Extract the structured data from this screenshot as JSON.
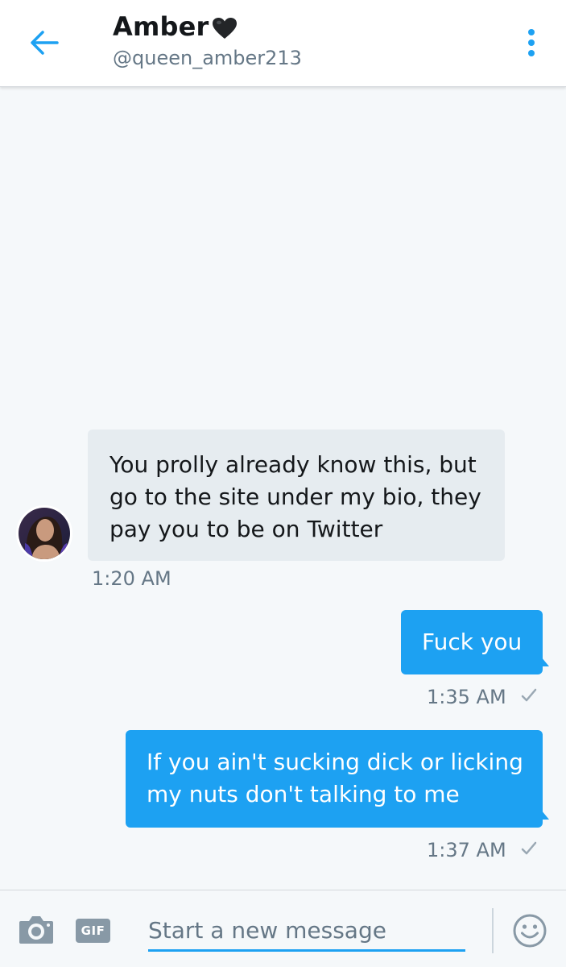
{
  "header": {
    "name": "Amber",
    "name_emoji": "black-heart-icon",
    "handle": "@queen_amber213",
    "back_icon": "arrow-left-icon",
    "more_icon": "more-vertical-icon"
  },
  "colors": {
    "accent": "#1da1f2",
    "incoming_bubble": "#e6ecf0",
    "outgoing_bubble": "#1da1f2",
    "secondary_text": "#657786",
    "background": "#f5f8fa"
  },
  "messages": [
    {
      "direction": "incoming",
      "text": "You prolly already know this, but go to the site under my bio, they pay you to be on Twitter",
      "time": "1:20 AM"
    },
    {
      "direction": "outgoing",
      "text": "Fuck you",
      "time": "1:35 AM",
      "status": "✓"
    },
    {
      "direction": "outgoing",
      "text": "If you ain't sucking dick or licking my nuts don't talking to me",
      "time": "1:37 AM",
      "status": "✓"
    }
  ],
  "composer": {
    "camera_icon": "camera-icon",
    "gif_label": "GIF",
    "placeholder": "Start a new message",
    "emoji_icon": "smiley-icon"
  }
}
